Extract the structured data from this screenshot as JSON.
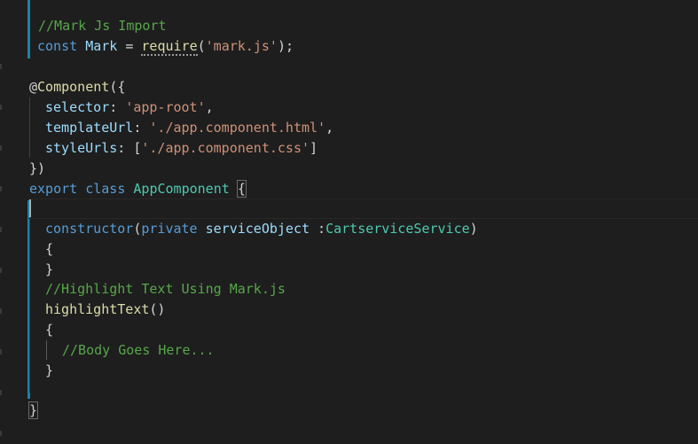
{
  "editor": {
    "language": "typescript",
    "colors": {
      "background": "#1e1e1e",
      "keyword": "#569cd6",
      "comment": "#57a64a",
      "string": "#ce9178",
      "function": "#dcdcaa",
      "type": "#4ec9b0",
      "variable": "#9cdcfe",
      "text": "#d4d4d4",
      "git_modified": "#1b81a8"
    },
    "code": {
      "l1_comment": "//Mark Js Import",
      "l2_const": "const",
      "l2_name": "Mark",
      "l2_eq": " = ",
      "l2_require": "require",
      "l2_open": "(",
      "l2_string": "'mark.js'",
      "l2_close": ");",
      "l3_at": "@",
      "l3_decorator": "Component",
      "l3_open": "({",
      "l4_key": "selector",
      "l4_colon": ": ",
      "l4_value": "'app-root'",
      "l4_comma": ",",
      "l5_key": "templateUrl",
      "l5_colon": ": ",
      "l5_value": "'./app.component.html'",
      "l5_comma": ",",
      "l6_key": "styleUrls",
      "l6_colon": ": [",
      "l6_value": "'./app.component.css'",
      "l6_close": "]",
      "l7_close": "})",
      "l8_export": "export",
      "l8_class": "class",
      "l8_name": "AppComponent",
      "l8_brace": "{",
      "l9_constructor": "constructor",
      "l9_open": "(",
      "l9_private": "private",
      "l9_param": "serviceObject",
      "l9_colon": " :",
      "l9_type": "CartserviceService",
      "l9_close": ")",
      "l10_open": "{",
      "l11_close": "}",
      "l12_comment": "//Highlight Text Using Mark.js",
      "l13_fn": "highlightText",
      "l13_parens": "()",
      "l14_open": "{",
      "l15_comment": "//Body Goes Here...",
      "l16_close": "}",
      "l17_close": "}"
    }
  }
}
